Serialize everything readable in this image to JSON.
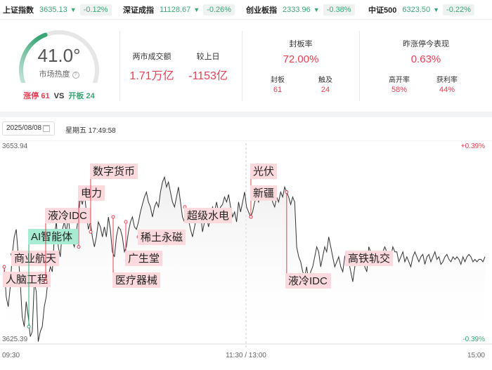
{
  "indices": [
    {
      "name": "上证指数",
      "price": "3635.13",
      "arrow": "▼",
      "pct": "-0.12%"
    },
    {
      "name": "深证成指",
      "price": "11128.67",
      "arrow": "▼",
      "pct": "-0.26%"
    },
    {
      "name": "创业板指",
      "price": "2333.96",
      "arrow": "▼",
      "pct": "-0.38%"
    },
    {
      "name": "中证500",
      "price": "6323.50",
      "arrow": "▼",
      "pct": "-0.22%"
    }
  ],
  "heat": {
    "value": "41.0°",
    "value_num": 41.0,
    "label": "市场热度",
    "info_icon": "?",
    "limit_up_label": "涨停 61",
    "vs": "VS",
    "limit_open_label": "开板 24"
  },
  "turnover": {
    "total_label": "两市成交额",
    "total_value": "1.71万亿",
    "change_label": "较上日",
    "change_value": "-1153亿"
  },
  "seal_rate": {
    "title": "封板率",
    "value": "72.00%",
    "sealed_label": "封板",
    "sealed_value": "61",
    "touched_label": "触及",
    "touched_value": "24"
  },
  "yesterday": {
    "title": "昨涨停今表现",
    "value": "0.63%",
    "high_open_label": "高开率",
    "high_open_value": "58%",
    "profit_label": "获利率",
    "profit_value": "44%"
  },
  "date": {
    "value": "2025/08/08",
    "weekday_time": "星期五 17:49:58"
  },
  "colors": {
    "up": "#e43f52",
    "down": "#3aa676",
    "gauge_track": "#e6e6e6",
    "tag_red": "#fbd9dd",
    "tag_green": "#a5ecd3"
  },
  "chart_data": {
    "type": "line",
    "series": [
      {
        "x": [
          0,
          1,
          2,
          3,
          4,
          5,
          6,
          7,
          8,
          9,
          10,
          11,
          12,
          13,
          14,
          15,
          16,
          17,
          18,
          19,
          20,
          21,
          22,
          23,
          24,
          25,
          26,
          27,
          28,
          29,
          30,
          31,
          32,
          33,
          34,
          35,
          36,
          37,
          38,
          39,
          40,
          41,
          42,
          43,
          44,
          45,
          46,
          47,
          48,
          49,
          50,
          51,
          52,
          53,
          54,
          55,
          56,
          57,
          58,
          59,
          60,
          61,
          62,
          63,
          64,
          65,
          66,
          67,
          68,
          69,
          70,
          71,
          72,
          73,
          74,
          75,
          76,
          77,
          78,
          79,
          80,
          81,
          82,
          83,
          84,
          85,
          86,
          87,
          88,
          89,
          90,
          91,
          92,
          93,
          94,
          95,
          96,
          97,
          98,
          99,
          100,
          101,
          102,
          103,
          104,
          105,
          106,
          107,
          108,
          109,
          110,
          111,
          112,
          113,
          114,
          115,
          116,
          117,
          118,
          119,
          120,
          121,
          122,
          123,
          124,
          125,
          126,
          127,
          128,
          129,
          130,
          131,
          132,
          133,
          134,
          135,
          136,
          137,
          138,
          139,
          140,
          141,
          142,
          143,
          144,
          145,
          146,
          147,
          148,
          149,
          150,
          151,
          152,
          153,
          154,
          155,
          156,
          157,
          158,
          159,
          160,
          161,
          162,
          163,
          164,
          165,
          166,
          167,
          168,
          169,
          170,
          171,
          172,
          173,
          174,
          175,
          176,
          177,
          178,
          179,
          180,
          181,
          182,
          183,
          184,
          185,
          186,
          187,
          188,
          189,
          190,
          191,
          192,
          193,
          194,
          195,
          196,
          197,
          198,
          199,
          200,
          201,
          202,
          203,
          204,
          205,
          206,
          207,
          208,
          209,
          210,
          211,
          212,
          213,
          214,
          215,
          216,
          217,
          218,
          219,
          220,
          221,
          222,
          223,
          224,
          225,
          226,
          227,
          228,
          229,
          230,
          231,
          232,
          233,
          234,
          235,
          236,
          237,
          238,
          239,
          240
        ],
        "y": [
          -0.1,
          -0.22,
          -0.26,
          -0.18,
          -0.05,
          0.02,
          0.05,
          -0.05,
          -0.16,
          -0.3,
          -0.34,
          -0.24,
          -0.3,
          -0.38,
          -0.36,
          -0.16,
          -0.2,
          -0.4,
          -0.36,
          -0.34,
          -0.26,
          -0.22,
          -0.14,
          -0.1,
          -0.12,
          0.02,
          0.08,
          -0.02,
          -0.06,
          0.05,
          0.08,
          0.04,
          0.1,
          0.02,
          0.0,
          -0.02,
          0.04,
          0.1,
          0.18,
          0.15,
          0.2,
          0.12,
          0.05,
          0.08,
          0.02,
          -0.02,
          0.02,
          0.08,
          0.06,
          0.02,
          0.06,
          0.02,
          0.1,
          0.05,
          -0.04,
          -0.06,
          0.02,
          0.06,
          0.05,
          0.02,
          -0.04,
          -0.02,
          0.04,
          0.08,
          0.1,
          0.06,
          0.05,
          0.08,
          0.12,
          0.15,
          0.18,
          0.2,
          0.16,
          0.14,
          0.1,
          0.14,
          0.16,
          0.14,
          0.2,
          0.24,
          0.26,
          0.22,
          0.24,
          0.2,
          0.16,
          0.14,
          0.18,
          0.22,
          0.16,
          0.1,
          0.08,
          0.12,
          0.09,
          0.05,
          0.02,
          0.06,
          0.1,
          0.08,
          0.12,
          0.04,
          0.08,
          0.1,
          0.06,
          0.1,
          0.14,
          0.12,
          0.16,
          0.12,
          0.14,
          0.15,
          0.18,
          0.16,
          0.19,
          0.14,
          0.1,
          0.12,
          0.08,
          0.16,
          0.12,
          0.16,
          0.2,
          0.14,
          0.12,
          0.1,
          0.12,
          0.16,
          0.18,
          0.16,
          0.2,
          0.22,
          0.18,
          0.18,
          0.22,
          0.2,
          0.16,
          0.14,
          0.18,
          0.16,
          0.2,
          0.18,
          0.22,
          0.2,
          0.18,
          0.15,
          0.18,
          0.16,
          -0.02,
          -0.06,
          -0.08,
          -0.12,
          -0.14,
          -0.1,
          -0.16,
          -0.12,
          -0.1,
          -0.06,
          -0.02,
          -0.04,
          -0.1,
          -0.06,
          -0.02,
          -0.04,
          0.02,
          -0.02,
          -0.06,
          -0.1,
          -0.08,
          -0.06,
          -0.1,
          -0.12,
          -0.06,
          -0.04,
          -0.08,
          -0.12,
          -0.16,
          -0.1,
          -0.08,
          -0.04,
          -0.08,
          -0.06,
          -0.1,
          -0.12,
          -0.02,
          -0.04,
          -0.06,
          -0.04,
          -0.06,
          -0.04,
          -0.08,
          -0.04,
          -0.02,
          -0.04,
          -0.08,
          -0.06,
          -0.02,
          -0.04,
          -0.04,
          -0.08,
          -0.06,
          -0.04,
          -0.08,
          -0.06,
          -0.08,
          -0.1,
          -0.06,
          -0.04,
          -0.06,
          -0.08,
          -0.06,
          -0.05,
          -0.09,
          -0.06,
          -0.05,
          -0.08,
          -0.06,
          -0.04,
          -0.07,
          -0.06,
          -0.09,
          -0.08,
          -0.06,
          -0.05,
          -0.07,
          -0.08,
          -0.06,
          -0.07,
          -0.06,
          -0.07,
          -0.09,
          -0.06,
          -0.08,
          -0.06,
          -0.05,
          -0.06,
          -0.08,
          -0.07,
          -0.08,
          -0.07,
          -0.07,
          -0.08,
          -0.06
        ]
      }
    ],
    "ylim": [
      -0.39,
      0.39
    ],
    "y_left_labels": {
      "top": "3653.94",
      "bottom": "3625.39"
    },
    "y_right_labels": {
      "top": "+0.39%",
      "bottom": "-0.39%"
    },
    "x_labels": {
      "start": "09:30",
      "mid": "11:30 / 13:00",
      "end": "15:00"
    },
    "grid": "dashed-vertical-at-midday",
    "annotations": [
      {
        "label": "人脑工程",
        "x": 0,
        "color": "red"
      },
      {
        "label": "商业航天",
        "x": 4,
        "color": "red"
      },
      {
        "label": "AI智能体",
        "x": 10,
        "color": "green"
      },
      {
        "label": "液冷IDC",
        "x": 15,
        "color": "red"
      },
      {
        "label": "电力",
        "x": 27,
        "color": "red"
      },
      {
        "label": "数字货币",
        "x": 31,
        "color": "red"
      },
      {
        "label": "医疗器械",
        "x": 37,
        "color": "red"
      },
      {
        "label": "广生堂",
        "x": 43,
        "color": "red"
      },
      {
        "label": "稀土永磁",
        "x": 46,
        "color": "red"
      },
      {
        "label": "超级水电",
        "x": 75,
        "color": "red"
      },
      {
        "label": "光伏",
        "x": 101,
        "color": "red"
      },
      {
        "label": "新疆",
        "x": 101,
        "color": "red"
      },
      {
        "label": "液冷IDC",
        "x": 141,
        "color": "red"
      },
      {
        "label": "高铁轨交",
        "x": 176,
        "color": "red"
      }
    ]
  }
}
